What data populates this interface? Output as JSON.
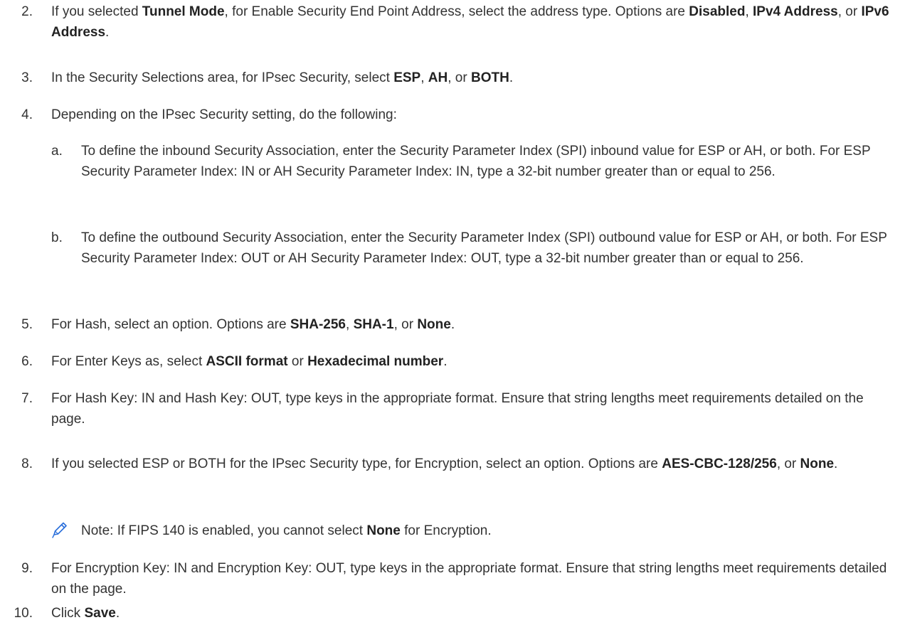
{
  "step2": {
    "num": "2.",
    "t1": "If you selected ",
    "b1": "Tunnel Mode",
    "t2": ", for Enable Security End Point Address, select the address type. Options are ",
    "b2": "Disabled",
    "t3": ", ",
    "b3": "IPv4 Address",
    "t4": ", or ",
    "b4": "IPv6 Address",
    "t5": "."
  },
  "step3": {
    "num": "3.",
    "t1": "In the Security Selections area, for IPsec Security, select ",
    "b1": "ESP",
    "t2": ", ",
    "b2": "AH",
    "t3": ", or ",
    "b3": "BOTH",
    "t4": "."
  },
  "step4": {
    "num": "4.",
    "text": "Depending on the IPsec Security setting, do the following:"
  },
  "step4a": {
    "num": "a.",
    "text": "To define the inbound Security Association, enter the Security Parameter Index (SPI) inbound value for ESP or AH, or both. For ESP Security Parameter Index: IN or AH Security Parameter Index: IN, type a 32-bit number greater than or equal to 256."
  },
  "step4b": {
    "num": "b.",
    "text": "To define the outbound Security Association, enter the Security Parameter Index (SPI) outbound value for ESP or AH, or both. For ESP Security Parameter Index: OUT or AH Security Parameter Index: OUT, type a 32-bit number greater than or equal to 256."
  },
  "step5": {
    "num": "5.",
    "t1": "For Hash, select an option. Options are ",
    "b1": "SHA-256",
    "t2": ", ",
    "b2": "SHA-1",
    "t3": ", or ",
    "b3": "None",
    "t4": "."
  },
  "step6": {
    "num": "6.",
    "t1": "For Enter Keys as, select ",
    "b1": "ASCII format",
    "t2": " or ",
    "b2": "Hexadecimal number",
    "t3": "."
  },
  "step7": {
    "num": "7.",
    "text": "For Hash Key: IN and Hash Key: OUT, type keys in the appropriate format. Ensure that string lengths meet requirements detailed on the page."
  },
  "step8": {
    "num": "8.",
    "t1": "If you selected ESP or BOTH for the IPsec Security type, for Encryption, select an option. Options are ",
    "b1": "AES-CBC-128/256",
    "t2": ", or ",
    "b2": "None",
    "t3": "."
  },
  "note": {
    "icon": "pencil-icon",
    "t1": "Note: If FIPS 140 is enabled, you cannot select ",
    "b1": "None",
    "t2": " for Encryption."
  },
  "step9": {
    "num": "9.",
    "text": "For Encryption Key: IN and Encryption Key: OUT, type keys in the appropriate format. Ensure that string lengths meet requirements detailed on the page."
  },
  "step10": {
    "num": "10.",
    "t1": "Click ",
    "b1": "Save",
    "t2": "."
  },
  "colors": {
    "text": "#333333",
    "bold": "#222222",
    "icon": "#2a6fdb"
  }
}
